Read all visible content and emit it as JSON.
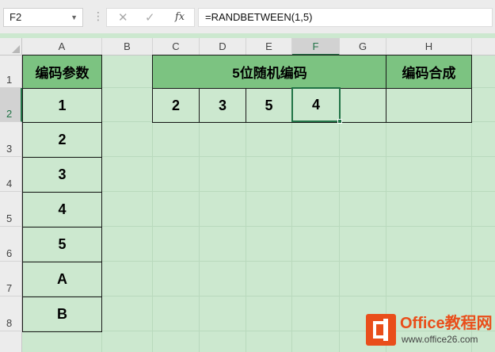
{
  "formula_bar": {
    "name_box": "F2",
    "cancel_glyph": "✕",
    "enter_glyph": "✓",
    "fx_label": "fx",
    "formula": "=RANDBETWEEN(1,5)"
  },
  "columns": [
    "A",
    "B",
    "C",
    "D",
    "E",
    "F",
    "G",
    "H"
  ],
  "rows": [
    "1",
    "2",
    "3",
    "4",
    "5",
    "6",
    "7",
    "8"
  ],
  "selected_cell": "F2",
  "cells": {
    "A1": "编码参数",
    "A2": "1",
    "A3": "2",
    "A4": "3",
    "A5": "4",
    "A6": "5",
    "A7": "A",
    "A8": "B",
    "C1": "5位随机编码",
    "C2": "2",
    "D2": "3",
    "E2": "5",
    "F2": "4",
    "H1": "编码合成"
  },
  "watermark": {
    "brand": "Office教程网",
    "url": "www.office26.com",
    "logo_icon": "office-logo-icon"
  },
  "colors": {
    "header_fill": "#7cc381",
    "sheet_background": "#cce8cf",
    "selection": "#217346",
    "brand": "#e94e1b"
  }
}
